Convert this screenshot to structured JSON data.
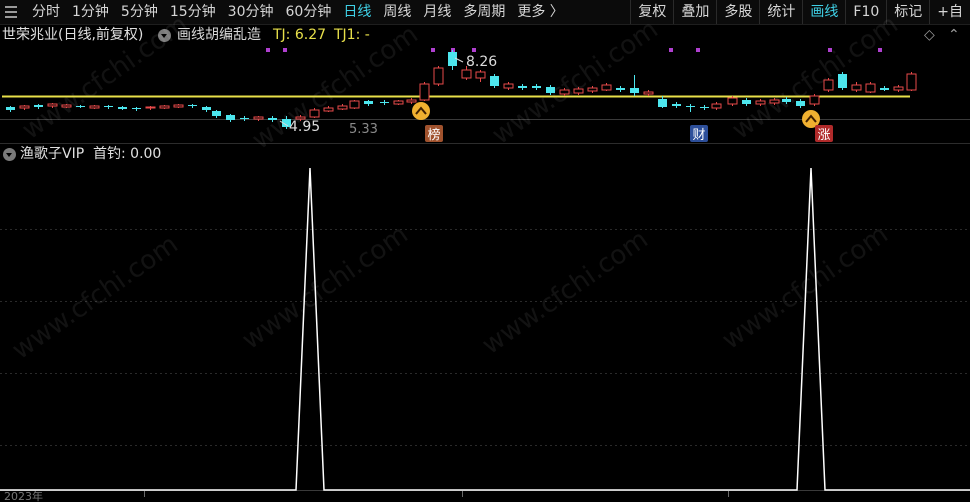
{
  "toolbar": {
    "periods": [
      "分时",
      "1分钟",
      "5分钟",
      "15分钟",
      "30分钟",
      "60分钟",
      "日线",
      "周线",
      "月线",
      "多周期",
      "更多 〉"
    ],
    "active_period": "日线",
    "actions": [
      "复权",
      "叠加",
      "多股",
      "统计",
      "画线",
      "F10",
      "标记",
      "+自"
    ],
    "active_action": "画线"
  },
  "chart": {
    "stock_title": "世荣兆业(日线,前复权)",
    "indicator_name": "画线胡编乱造",
    "tj_text": "TJ: 6.27",
    "tj1_text": "TJ1: -",
    "high_label": "8.26",
    "low_label": "4.95",
    "partial_label": "5.33",
    "badges": [
      "榜",
      "财",
      "涨"
    ],
    "colors": {
      "up": "#e84a4a",
      "down": "#4de6ee",
      "line": "#e8e04a",
      "accent": "#3fd0e6"
    }
  },
  "indicator": {
    "name": "渔歌子VIP",
    "value_text": "首钓: 0.00",
    "spike_values": [
      1,
      1
    ]
  },
  "axis": {
    "year_label": "2023年"
  },
  "watermark": "www.cfchi.com"
}
